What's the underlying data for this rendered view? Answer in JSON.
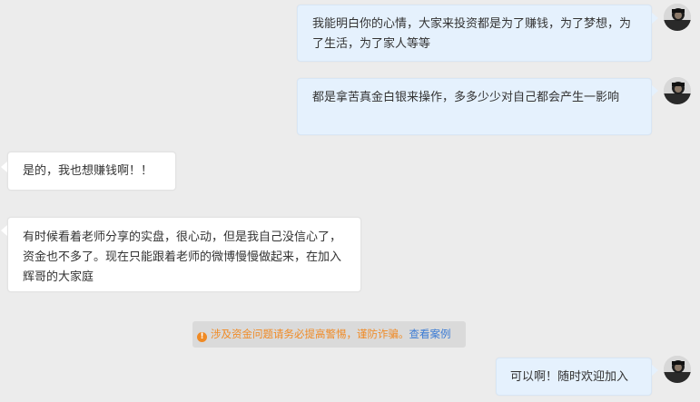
{
  "messages": [
    {
      "side": "right",
      "text": "我能明白你的心情，大家来投资都是为了赚钱，为了梦想，为了生活，为了家人等等"
    },
    {
      "side": "right",
      "text": "都是拿苦真金白银来操作，多多少少对自己都会产生一影响"
    },
    {
      "side": "left",
      "text": "是的，我也想赚钱啊！！"
    },
    {
      "side": "left",
      "text": "有时候看着老师分享的实盘，很心动，但是我自己没信心了，资金也不多了。现在只能跟着老师的微博慢慢做起来，在加入辉哥的大家庭"
    },
    {
      "side": "right",
      "text": "可以啊！随时欢迎加入"
    }
  ],
  "notice": {
    "icon": "warning-icon",
    "text": "涉及资金问题请务必提高警惕，谨防诈骗。",
    "link": "查看案例"
  },
  "colors": {
    "background": "#ececec",
    "outgoing_bubble": "#e5f1fd",
    "incoming_bubble": "#ffffff",
    "warning": "#f08a24",
    "link": "#3b7bd4"
  }
}
